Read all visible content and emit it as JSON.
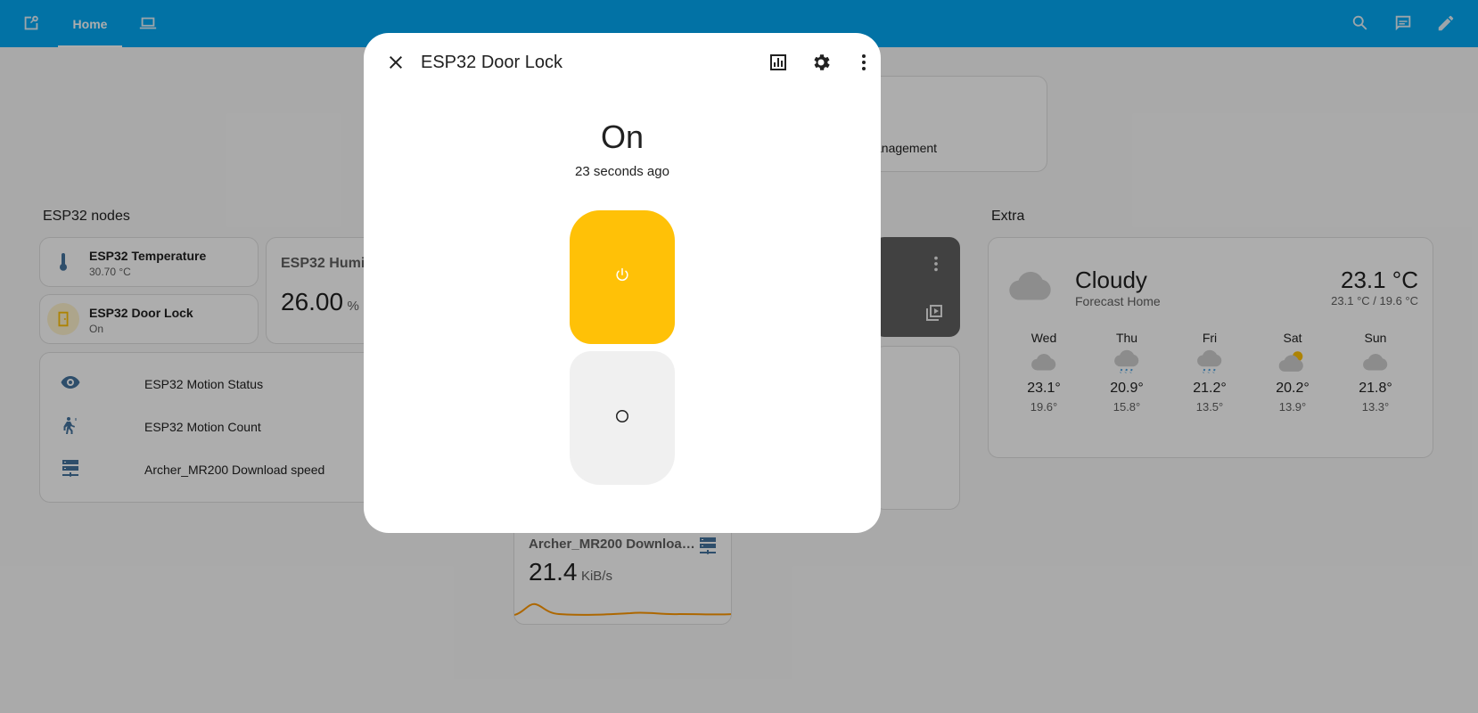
{
  "topbar": {
    "tab_home_label": "Home",
    "icons": [
      "image-search-icon",
      "laptop-icon",
      "search-icon",
      "chat-icon",
      "pencil-icon"
    ]
  },
  "header_card": {
    "text": "anagement"
  },
  "esp32_section": {
    "title": "ESP32 nodes",
    "temperature_tile": {
      "name": "ESP32 Temperature",
      "state": "30.70 °C"
    },
    "doorlock_tile": {
      "name": "ESP32 Door Lock",
      "state": "On"
    },
    "humidity_card": {
      "name": "ESP32 Humic",
      "value": "26.00",
      "unit": "%"
    },
    "entities": [
      {
        "label": "ESP32 Motion Status",
        "icon": "eye-icon"
      },
      {
        "label": "ESP32 Motion Count",
        "icon": "motion-sensor-icon"
      },
      {
        "label": "Archer_MR200 Download speed",
        "icon": "server-network-icon"
      }
    ]
  },
  "download_card": {
    "name": "Archer_MR200 Downloa…",
    "value": "21.4",
    "unit": "KiB/s"
  },
  "extra_section": {
    "title": "Extra",
    "weather": {
      "condition": "Cloudy",
      "location": "Forecast Home",
      "temperature": "23.1 °C",
      "range": "23.1 °C / 19.6 °C",
      "forecast": [
        {
          "day": "Wed",
          "hi": "23.1°",
          "lo": "19.6°",
          "icon": "cloudy-icon"
        },
        {
          "day": "Thu",
          "hi": "20.9°",
          "lo": "15.8°",
          "icon": "rainy-icon"
        },
        {
          "day": "Fri",
          "hi": "21.2°",
          "lo": "13.5°",
          "icon": "rainy-icon"
        },
        {
          "day": "Sat",
          "hi": "20.2°",
          "lo": "13.9°",
          "icon": "partly-cloudy-icon"
        },
        {
          "day": "Sun",
          "hi": "21.8°",
          "lo": "13.3°",
          "icon": "cloudy-icon"
        }
      ]
    }
  },
  "dialog": {
    "title": "ESP32 Door Lock",
    "state": "On",
    "last_changed": "23 seconds ago",
    "switch_state": "on"
  },
  "colors": {
    "primary": "#03a9f4",
    "accent": "#ffc107",
    "icon": "#44739e"
  }
}
